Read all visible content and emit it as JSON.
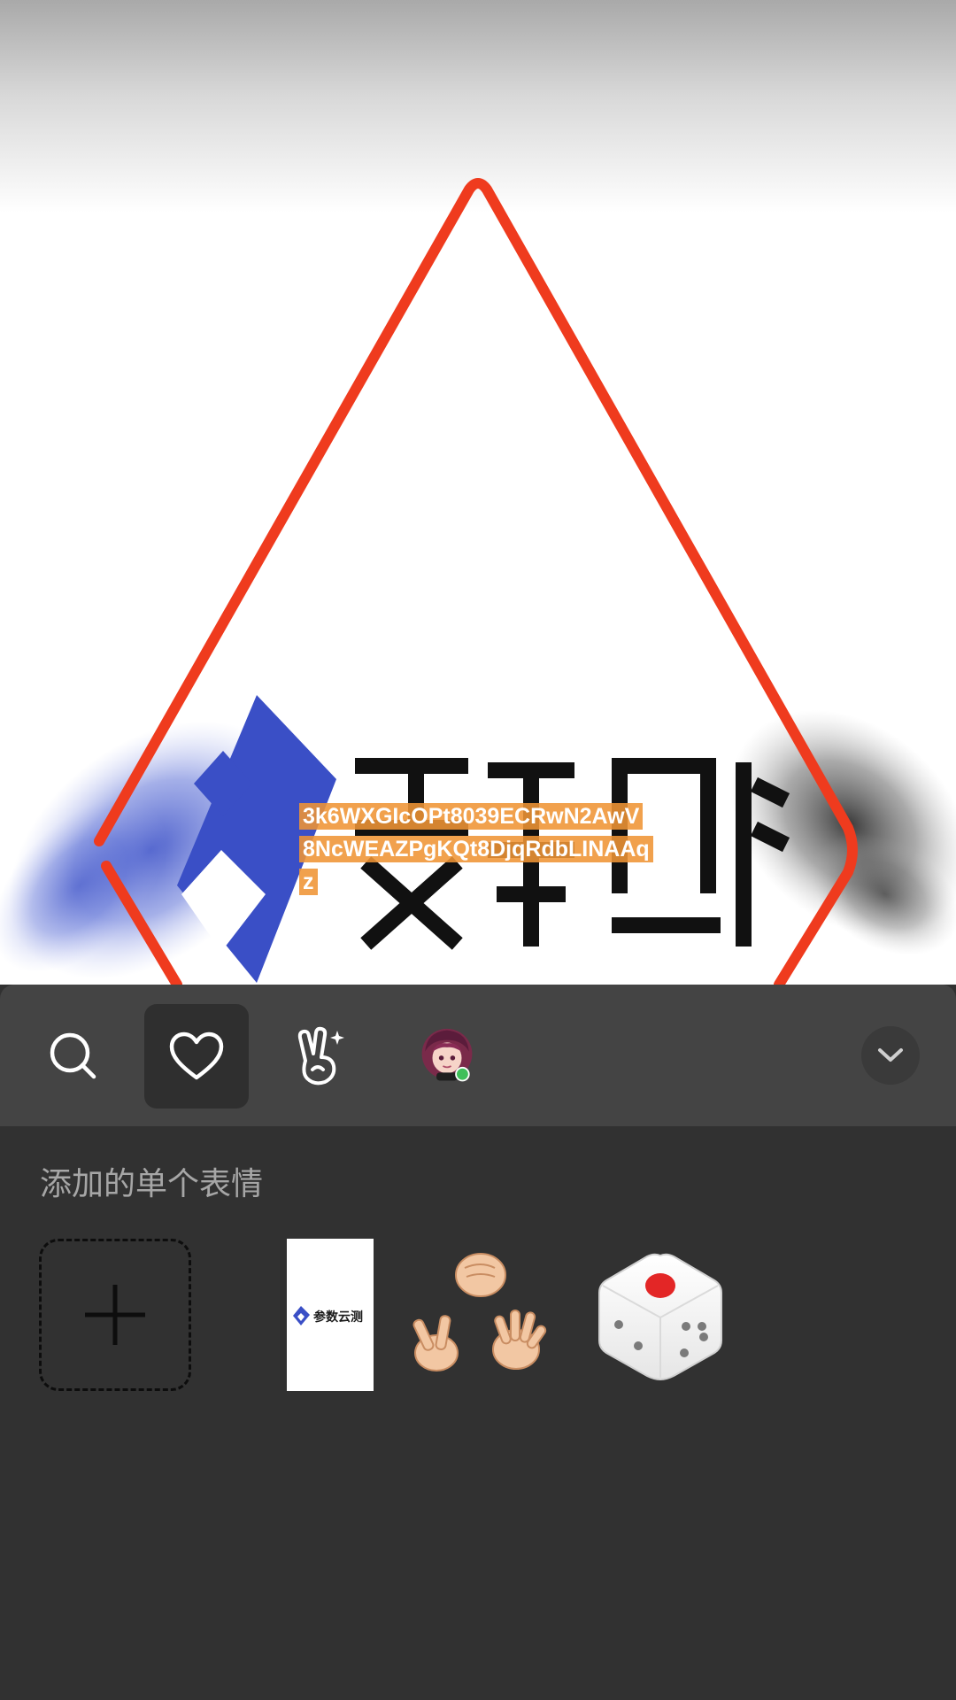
{
  "viewer": {
    "image_id_text": "3k6WXGIcOPt8039ECRwN2AwV8NcWEAZPgKQt8DjqRdbLINAAqz",
    "logo_text_mirrored": "参数云测",
    "colors": {
      "frame": "#ef3b1e",
      "logo_blue": "#3a4fc6",
      "label_bg": "#ef9434"
    }
  },
  "emoji_panel": {
    "tabs": [
      {
        "icon": "search-icon",
        "active": false
      },
      {
        "icon": "heart-icon",
        "active": true
      },
      {
        "icon": "hand-gesture-icon",
        "active": false
      },
      {
        "icon": "avatar-sticker-icon",
        "active": false
      }
    ],
    "collapse_icon": "chevron-down-icon",
    "section_title": "添加的单个表情",
    "stickers": [
      {
        "icon": "add-plus-icon"
      },
      {
        "icon": "logo-sticker",
        "text": "参数云测"
      },
      {
        "icon": "rock-paper-scissors-sticker"
      },
      {
        "icon": "dice-sticker"
      }
    ],
    "colors": {
      "panel_bg": "#313131",
      "tabbar_bg": "#444444",
      "active_tab_bg": "#2f2f2f",
      "title_text": "#a6a6a6"
    }
  }
}
